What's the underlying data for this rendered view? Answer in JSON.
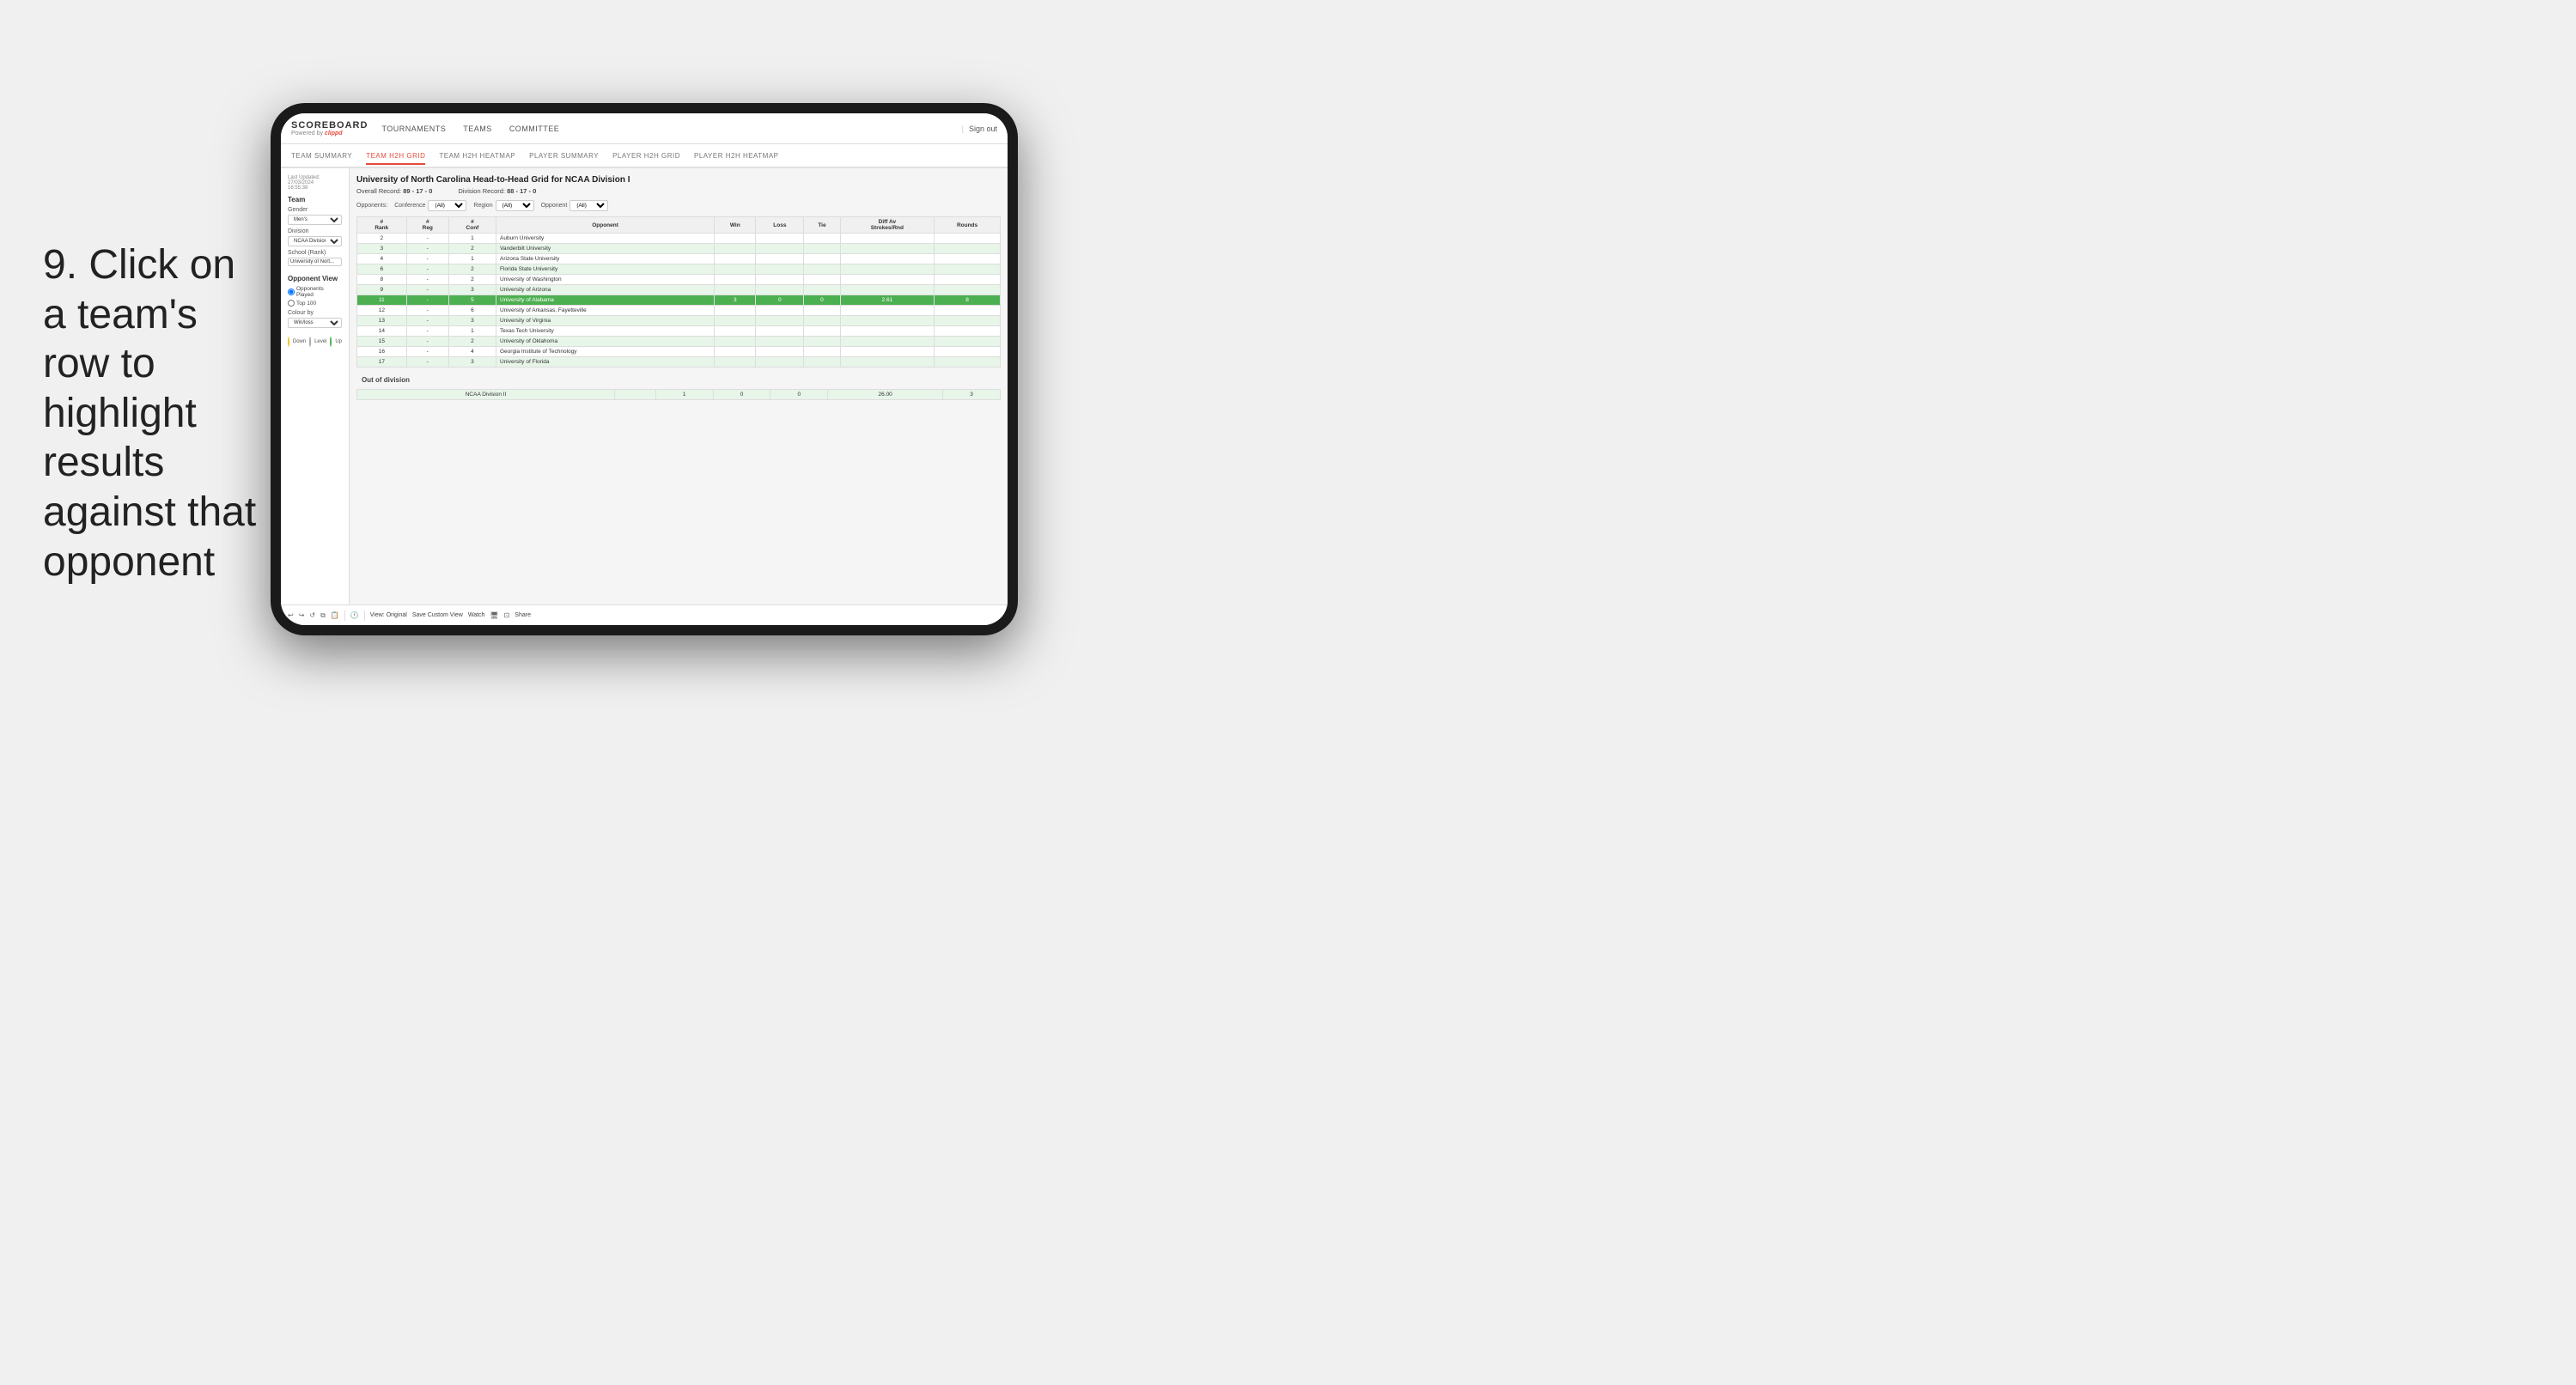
{
  "instruction": {
    "step": "9.",
    "text": "Click on a team's row to highlight results against that opponent"
  },
  "nav": {
    "logo": "SCOREBOARD",
    "powered_by": "Powered by",
    "brand": "clippd",
    "items": [
      "TOURNAMENTS",
      "TEAMS",
      "COMMITTEE"
    ],
    "sign_out": "Sign out"
  },
  "sub_nav": {
    "items": [
      "TEAM SUMMARY",
      "TEAM H2H GRID",
      "TEAM H2H HEATMAP",
      "PLAYER SUMMARY",
      "PLAYER H2H GRID",
      "PLAYER H2H HEATMAP"
    ],
    "active": "TEAM H2H GRID"
  },
  "sidebar": {
    "last_updated_label": "Last Updated: 27/03/2024",
    "time": "16:55:38",
    "team_label": "Team",
    "gender_label": "Gender",
    "gender_value": "Men's",
    "division_label": "Division",
    "division_value": "NCAA Division I",
    "school_label": "School (Rank)",
    "school_value": "University of Nort...",
    "opponent_view_label": "Opponent View",
    "radio_opponents": "Opponents Played",
    "radio_top100": "Top 100",
    "colour_by_label": "Colour by",
    "colour_value": "Win/loss",
    "legend": [
      {
        "color": "#f4c430",
        "label": "Down"
      },
      {
        "color": "#aaa",
        "label": "Level"
      },
      {
        "color": "#4caf50",
        "label": "Up"
      }
    ]
  },
  "grid": {
    "title": "University of North Carolina Head-to-Head Grid for NCAA Division I",
    "overall_record_label": "Overall Record:",
    "overall_record": "89 - 17 - 0",
    "division_record_label": "Division Record:",
    "division_record": "88 - 17 - 0",
    "filters": {
      "opponents_label": "Opponents:",
      "conference_label": "Conference",
      "conference_value": "(All)",
      "region_label": "Region",
      "region_value": "(All)",
      "opponent_label": "Opponent",
      "opponent_value": "(All)"
    },
    "table_headers": [
      "#Rank",
      "#Reg",
      "#Conf",
      "Opponent",
      "Win",
      "Loss",
      "Tie",
      "Diff Av Strokes/Rnd",
      "Rounds"
    ],
    "rows": [
      {
        "rank": "2",
        "reg": "-",
        "conf": "1",
        "opponent": "Auburn University",
        "win": "",
        "loss": "",
        "tie": "",
        "diff": "",
        "rounds": "",
        "style": "normal"
      },
      {
        "rank": "3",
        "reg": "-",
        "conf": "2",
        "opponent": "Vanderbilt University",
        "win": "",
        "loss": "",
        "tie": "",
        "diff": "",
        "rounds": "",
        "style": "light-green"
      },
      {
        "rank": "4",
        "reg": "-",
        "conf": "1",
        "opponent": "Arizona State University",
        "win": "",
        "loss": "",
        "tie": "",
        "diff": "",
        "rounds": "",
        "style": "normal"
      },
      {
        "rank": "6",
        "reg": "-",
        "conf": "2",
        "opponent": "Florida State University",
        "win": "",
        "loss": "",
        "tie": "",
        "diff": "",
        "rounds": "",
        "style": "light-green"
      },
      {
        "rank": "8",
        "reg": "-",
        "conf": "2",
        "opponent": "University of Washington",
        "win": "",
        "loss": "",
        "tie": "",
        "diff": "",
        "rounds": "",
        "style": "normal"
      },
      {
        "rank": "9",
        "reg": "-",
        "conf": "3",
        "opponent": "University of Arizona",
        "win": "",
        "loss": "",
        "tie": "",
        "diff": "",
        "rounds": "",
        "style": "light-green"
      },
      {
        "rank": "11",
        "reg": "-",
        "conf": "5",
        "opponent": "University of Alabama",
        "win": "3",
        "loss": "0",
        "tie": "0",
        "diff": "2.61",
        "rounds": "8",
        "style": "highlighted"
      },
      {
        "rank": "12",
        "reg": "-",
        "conf": "6",
        "opponent": "University of Arkansas, Fayetteville",
        "win": "",
        "loss": "",
        "tie": "",
        "diff": "",
        "rounds": "",
        "style": "normal"
      },
      {
        "rank": "13",
        "reg": "-",
        "conf": "3",
        "opponent": "University of Virginia",
        "win": "",
        "loss": "",
        "tie": "",
        "diff": "",
        "rounds": "",
        "style": "light-green"
      },
      {
        "rank": "14",
        "reg": "-",
        "conf": "1",
        "opponent": "Texas Tech University",
        "win": "",
        "loss": "",
        "tie": "",
        "diff": "",
        "rounds": "",
        "style": "normal"
      },
      {
        "rank": "15",
        "reg": "-",
        "conf": "2",
        "opponent": "University of Oklahoma",
        "win": "",
        "loss": "",
        "tie": "",
        "diff": "",
        "rounds": "",
        "style": "light-green"
      },
      {
        "rank": "16",
        "reg": "-",
        "conf": "4",
        "opponent": "Georgia Institute of Technology",
        "win": "",
        "loss": "",
        "tie": "",
        "diff": "",
        "rounds": "",
        "style": "normal"
      },
      {
        "rank": "17",
        "reg": "-",
        "conf": "3",
        "opponent": "University of Florida",
        "win": "",
        "loss": "",
        "tie": "",
        "diff": "",
        "rounds": "",
        "style": "light-green"
      }
    ],
    "out_of_division_label": "Out of division",
    "out_div_rows": [
      {
        "division": "NCAA Division II",
        "win": "1",
        "loss": "0",
        "tie": "0",
        "diff": "26.00",
        "rounds": "3",
        "style": "out-div"
      }
    ]
  },
  "toolbar": {
    "icons": [
      "undo",
      "redo",
      "undo-alt",
      "copy",
      "paste",
      "separator",
      "clock",
      "separator2"
    ],
    "view_label": "View: Original",
    "save_custom": "Save Custom View",
    "watch_label": "Watch",
    "share_label": "Share"
  }
}
